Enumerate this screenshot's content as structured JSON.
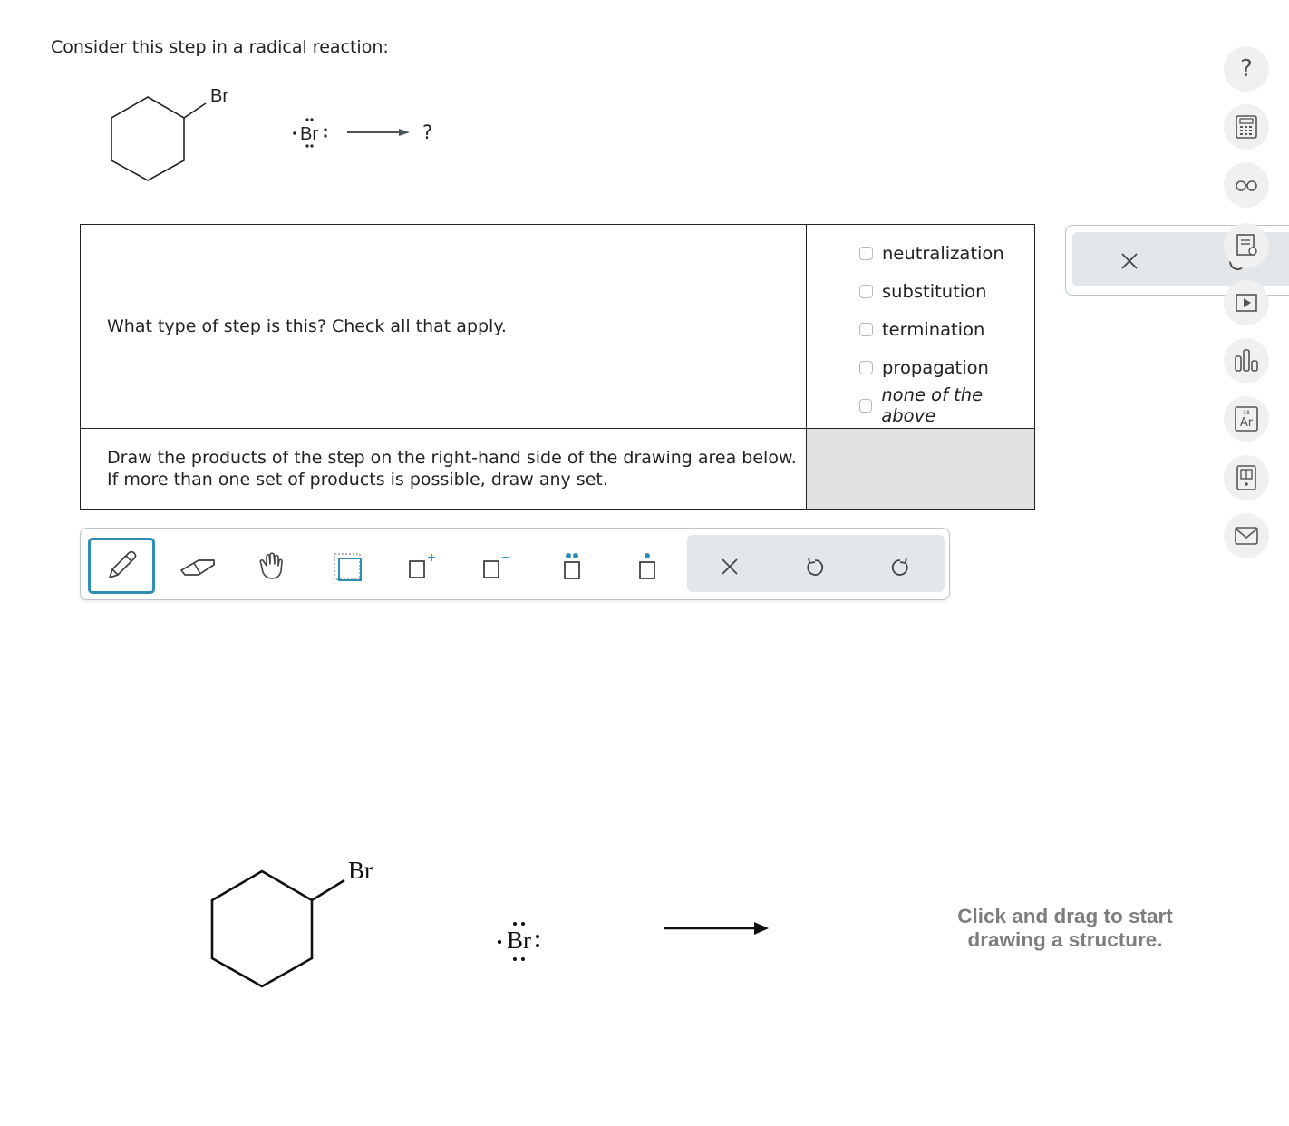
{
  "question": {
    "prompt": "Consider this step in a radical reaction:",
    "reaction": {
      "reactant_label": "Br",
      "radical_label": "Br",
      "product_placeholder": "?"
    }
  },
  "table": {
    "q1_text": "What type of step is this? Check all that apply.",
    "options": [
      {
        "label": "neutralization",
        "checked": false
      },
      {
        "label": "substitution",
        "checked": false
      },
      {
        "label": "termination",
        "checked": false
      },
      {
        "label": "propagation",
        "checked": false
      },
      {
        "label": "none of the above",
        "checked": false
      }
    ],
    "q2_text": "Draw the products of the step on the right-hand side of the drawing area below. If more than one set of products is possible, draw any set."
  },
  "toolbar": {
    "tools": [
      "pencil-icon",
      "eraser-icon",
      "hand-icon",
      "select-box-icon",
      "add-charge-icon",
      "remove-charge-icon",
      "lone-pair-icon",
      "radical-icon"
    ],
    "actions": [
      "close-icon",
      "undo-icon",
      "redo-icon"
    ],
    "active_tool": "pencil"
  },
  "canvas": {
    "reactant_label": "Br",
    "radical_label": "Br",
    "hint": "Click and drag to start drawing a structure."
  },
  "sidebar": {
    "buttons": [
      "help-icon",
      "calculator-icon",
      "glasses-icon",
      "textbook-icon",
      "video-icon",
      "chart-icon",
      "periodic-table-icon",
      "data-icon",
      "mail-icon"
    ],
    "help_glyph": "?",
    "periodic_symbol": "Ar",
    "periodic_number": "18"
  },
  "accent_color": "#2e8cb5"
}
